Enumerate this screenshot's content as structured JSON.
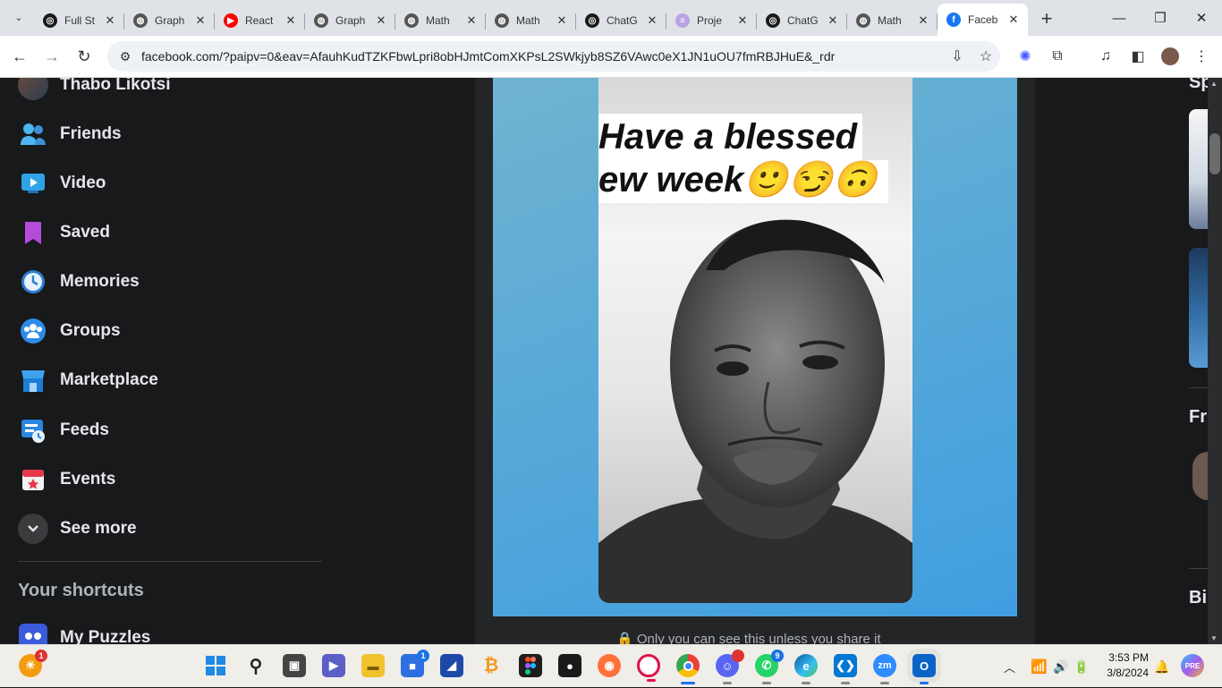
{
  "browser": {
    "tabs": [
      {
        "title": "Full St",
        "icon": "openai-icon",
        "color": "#1a1a1a",
        "glyph": "◎"
      },
      {
        "title": "Graph",
        "icon": "globe-icon",
        "color": "#555555",
        "glyph": "◍"
      },
      {
        "title": "React",
        "icon": "youtube-icon",
        "color": "#ff0000",
        "glyph": "▶"
      },
      {
        "title": "Graph",
        "icon": "globe-icon",
        "color": "#555555",
        "glyph": "◍"
      },
      {
        "title": "Math",
        "icon": "globe-icon",
        "color": "#555555",
        "glyph": "◍"
      },
      {
        "title": "Math",
        "icon": "globe-icon",
        "color": "#555555",
        "glyph": "◍"
      },
      {
        "title": "ChatG",
        "icon": "openai-icon",
        "color": "#1a1a1a",
        "glyph": "◎"
      },
      {
        "title": "Proje",
        "icon": "doc-icon",
        "color": "#b9a3e3",
        "glyph": "≡"
      },
      {
        "title": "ChatG",
        "icon": "openai-icon",
        "color": "#1a1a1a",
        "glyph": "◎"
      },
      {
        "title": "Math",
        "icon": "globe-icon",
        "color": "#555555",
        "glyph": "◍"
      },
      {
        "title": "Faceb",
        "icon": "facebook-icon",
        "color": "#1877f2",
        "glyph": "f",
        "active": true
      }
    ],
    "url": "facebook.com/?paipv=0&eav=AfauhKudTZKFbwLpri8obHJmtComXKPsL2SWkjyb8SZ6VAwc0eX1JN1uOU7fmRBJHuE&_rdr"
  },
  "sidebar": {
    "profile_name": "Thabo Likotsi",
    "items": [
      {
        "label": "Friends",
        "icon": "friends-icon"
      },
      {
        "label": "Video",
        "icon": "video-icon"
      },
      {
        "label": "Saved",
        "icon": "saved-icon"
      },
      {
        "label": "Memories",
        "icon": "memories-icon"
      },
      {
        "label": "Groups",
        "icon": "groups-icon"
      },
      {
        "label": "Marketplace",
        "icon": "marketplace-icon"
      },
      {
        "label": "Feeds",
        "icon": "feeds-icon"
      },
      {
        "label": "Events",
        "icon": "events-icon"
      },
      {
        "label": "See more",
        "icon": "chevron-down-icon"
      }
    ],
    "shortcuts_title": "Your shortcuts",
    "shortcuts": [
      {
        "label": "My Puzzles",
        "icon": "puzzle-icon"
      }
    ]
  },
  "story": {
    "caption_line1": "Have a blessed",
    "caption_line2": "ew week🙂😏🙃",
    "privacy_text": "Only you can see this unless you share it"
  },
  "right_column": {
    "partial_headings": [
      "Sp",
      "Fr",
      "Bi"
    ]
  },
  "taskbar": {
    "weather_badge": "1",
    "store_badge": "1",
    "whatsapp_badge": "9",
    "time": "3:53 PM",
    "date": "3/8/2024"
  },
  "colors": {
    "facebook_blue": "#1877f2",
    "page_bg": "#18191a",
    "card_bg": "#242526",
    "story_bg": "#4aa3db"
  }
}
